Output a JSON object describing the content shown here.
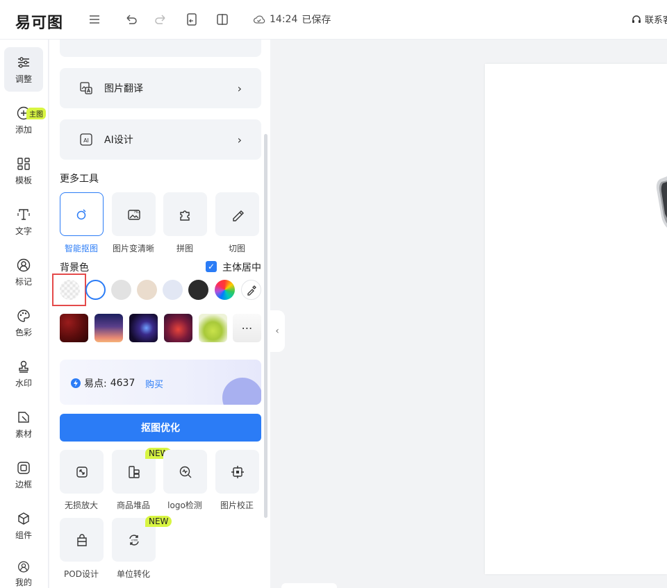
{
  "topbar": {
    "logo": "易可图",
    "save_time": "14:24",
    "save_label": "已保存",
    "contact": "联系客服"
  },
  "leftnav": {
    "items": [
      {
        "label": "调整",
        "icon": "sliders-icon",
        "active": true
      },
      {
        "label": "添加",
        "icon": "plus-circle-icon"
      },
      {
        "label": "模板",
        "icon": "grid-icon",
        "badge": "主图"
      },
      {
        "label": "文字",
        "icon": "text-icon"
      },
      {
        "label": "标记",
        "icon": "person-mark-icon"
      },
      {
        "label": "色彩",
        "icon": "palette-icon"
      },
      {
        "label": "水印",
        "icon": "stamp-icon"
      },
      {
        "label": "素材",
        "icon": "material-icon"
      },
      {
        "label": "边框",
        "icon": "frame-icon"
      },
      {
        "label": "组件",
        "icon": "cube-icon"
      },
      {
        "label": "我的",
        "icon": "user-icon"
      }
    ]
  },
  "panel": {
    "cards": [
      {
        "label": "图片翻译",
        "icon": "image-translate-icon"
      },
      {
        "label": "AI设计",
        "icon": "ai-design-icon"
      }
    ],
    "more_tools_title": "更多工具",
    "tools": [
      {
        "label": "智能抠图",
        "icon": "smart-cutout-icon",
        "active": true
      },
      {
        "label": "图片变清晰",
        "icon": "hd-image-icon"
      },
      {
        "label": "拼图",
        "icon": "puzzle-icon"
      },
      {
        "label": "切图",
        "icon": "knife-icon"
      }
    ],
    "bg_color_title": "背景色",
    "center_subject_label": "主体居中",
    "center_subject_checked": true,
    "swatches": [
      "transparent",
      "#ffffff",
      "#e2e2e2",
      "#eadccd",
      "#e2e7f4",
      "#2b2b2b",
      "rainbow",
      "eyedropper"
    ],
    "promo": {
      "points_label": "易点:",
      "points_value": "4637",
      "buy_label": "购买"
    },
    "cta_label": "抠图优化",
    "extra_tools": [
      {
        "label": "无损放大",
        "icon": "upscale-icon"
      },
      {
        "label": "商品堆品",
        "icon": "stack-products-icon",
        "tag": "NEW"
      },
      {
        "label": "logo检测",
        "icon": "logo-detect-icon"
      },
      {
        "label": "图片校正",
        "icon": "correction-icon"
      },
      {
        "label": "POD设计",
        "icon": "pod-bag-icon"
      },
      {
        "label": "单位转化",
        "icon": "unit-convert-icon",
        "tag": "NEW"
      }
    ]
  },
  "colors": {
    "accent": "#2b7cf6",
    "new_tag": "#d8f542",
    "highlight_box": "#e44a4a"
  }
}
